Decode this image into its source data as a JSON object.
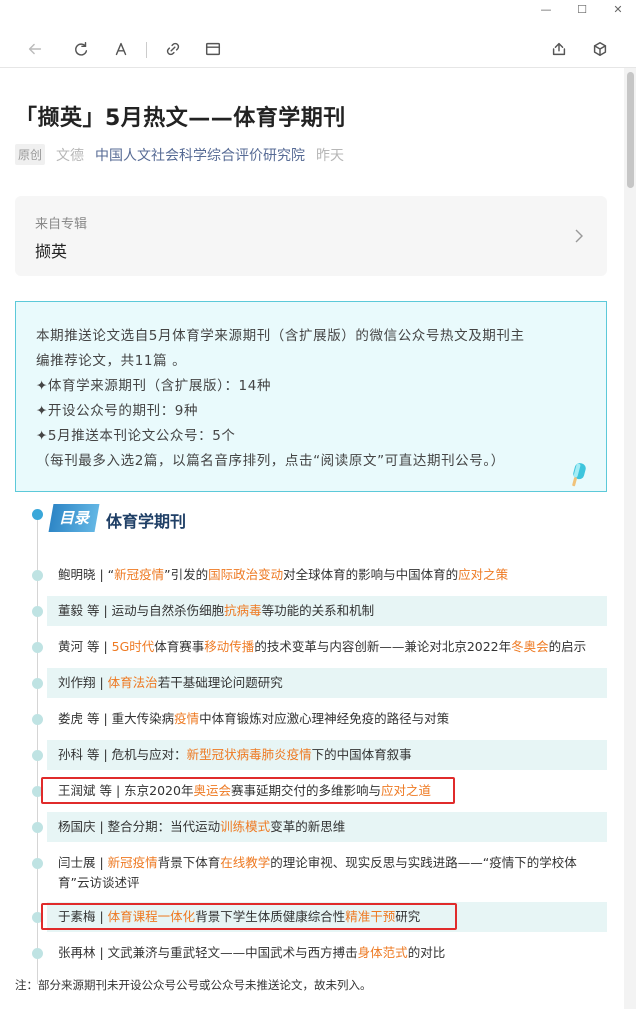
{
  "window": {
    "minimize": "—",
    "maximize": "☐",
    "close": "✕"
  },
  "article": {
    "title": "「撷英」5月热文——体育学期刊",
    "badge": "原创",
    "author": "文德",
    "account": "中国人文社会科学综合评价研究院",
    "time": "昨天"
  },
  "album": {
    "label": "来自专辑",
    "name": "撷英"
  },
  "intro": {
    "lines": [
      "本期推送论文选自5月体育学来源期刊（含扩展版）的微信公众号热文及期刊主",
      "编推荐论文，共11篇 。",
      "✦体育学来源期刊（含扩展版）：14种",
      "✦开设公众号的期刊：9种",
      "✦5月推送本刊论文公众号：5个",
      "（每刊最多入选2篇，以篇名音序排列，点击“阅读原文”可直达期刊公号。）"
    ]
  },
  "toc": {
    "badge": "目录",
    "heading": "体育学期刊",
    "items": [
      {
        "segments": [
          {
            "t": "鲍明晓 | “"
          },
          {
            "t": "新冠疫情",
            "h": true
          },
          {
            "t": "”引发的"
          },
          {
            "t": "国际政治变动",
            "h": true
          },
          {
            "t": "对全球体育的影响与中国体育的"
          },
          {
            "t": "应对之策",
            "h": true
          }
        ]
      },
      {
        "segments": [
          {
            "t": "董毅 等 | 运动与自然杀伤细胞"
          },
          {
            "t": "抗病毒",
            "h": true
          },
          {
            "t": "等功能的关系和机制"
          }
        ]
      },
      {
        "segments": [
          {
            "t": "黄河 等 | "
          },
          {
            "t": "5G时代",
            "h": true
          },
          {
            "t": "体育赛事"
          },
          {
            "t": "移动传播",
            "h": true
          },
          {
            "t": "的技术变革与内容创新——兼论对北京2022年"
          },
          {
            "t": "冬奥会",
            "h": true
          },
          {
            "t": "的启示"
          }
        ]
      },
      {
        "segments": [
          {
            "t": "刘作翔 | "
          },
          {
            "t": "体育法治",
            "h": true
          },
          {
            "t": "若干基础理论问题研究"
          }
        ]
      },
      {
        "segments": [
          {
            "t": "娄虎 等 | 重大传染病"
          },
          {
            "t": "疫情",
            "h": true
          },
          {
            "t": "中体育锻炼对应激心理神经免疫的路径与对策"
          }
        ]
      },
      {
        "segments": [
          {
            "t": "孙科 等 | 危机与应对："
          },
          {
            "t": "新型冠状病毒肺炎疫情",
            "h": true
          },
          {
            "t": "下的中国体育叙事"
          }
        ]
      },
      {
        "segments": [
          {
            "t": "王润斌 等 | 东京2020年"
          },
          {
            "t": "奥运会",
            "h": true
          },
          {
            "t": "赛事延期交付的多维影响与"
          },
          {
            "t": "应对之道",
            "h": true
          }
        ]
      },
      {
        "segments": [
          {
            "t": "杨国庆 | 整合分期：当代运动"
          },
          {
            "t": "训练模式",
            "h": true
          },
          {
            "t": "变革的新思维"
          }
        ]
      },
      {
        "segments": [
          {
            "t": "闫士展 | "
          },
          {
            "t": "新冠疫情",
            "h": true
          },
          {
            "t": "背景下体育"
          },
          {
            "t": "在线教学",
            "h": true
          },
          {
            "t": "的理论审视、现实反思与实践进路——“疫情下的学校体"
          }
        ],
        "line2": "育”云访谈述评"
      },
      {
        "segments": [
          {
            "t": "于素梅 | "
          },
          {
            "t": "体育课程一体化",
            "h": true
          },
          {
            "t": "背景下学生体质健康综合性"
          },
          {
            "t": "精准干预",
            "h": true
          },
          {
            "t": "研究"
          }
        ]
      },
      {
        "segments": [
          {
            "t": "张再林 | 文武兼济与重武轻文——中国武术与西方搏击"
          },
          {
            "t": "身体范式",
            "h": true
          },
          {
            "t": "的对比"
          }
        ]
      }
    ]
  },
  "note": "注：部分来源期刊未开设公众号公号或公众号未推送论文，故未列入。",
  "colors": {
    "highlight": "#ee7a23",
    "accent": "#3aa7d9",
    "box": "#5cc9d9",
    "link": "#576b95",
    "mark": "#e02b2b"
  }
}
